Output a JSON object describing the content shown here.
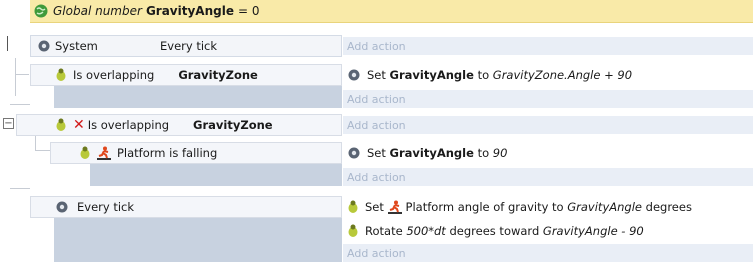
{
  "global_var": {
    "prefix": "Global number",
    "name": "GravityAngle",
    "suffix": "= 0"
  },
  "system_header": {
    "object": "System",
    "condition": "Every tick"
  },
  "add_action": "Add action",
  "events": [
    {
      "condition": {
        "verb": "Is overlapping",
        "target": "GravityZone"
      },
      "action": {
        "prefix": "Set",
        "variable": "GravityAngle",
        "middle": "to",
        "expression": "GravityZone.Angle + 90"
      }
    },
    {
      "condition": {
        "verb": "Is overlapping",
        "target": "GravityZone"
      },
      "toggle": "−"
    },
    {
      "condition": {
        "label": "Platform is falling"
      },
      "action": {
        "prefix": "Set",
        "variable": "GravityAngle",
        "middle": "to",
        "expression": "90"
      }
    },
    {
      "condition": {
        "label": "Every tick"
      },
      "actions": [
        {
          "prefix": "Set",
          "middle": "Platform angle of gravity to",
          "expression": "GravityAngle",
          "suffix": "degrees"
        },
        {
          "prefix": "Rotate",
          "expression": "500*dt",
          "middle": "degrees toward",
          "expression2": "GravityAngle - 90"
        }
      ]
    }
  ]
}
